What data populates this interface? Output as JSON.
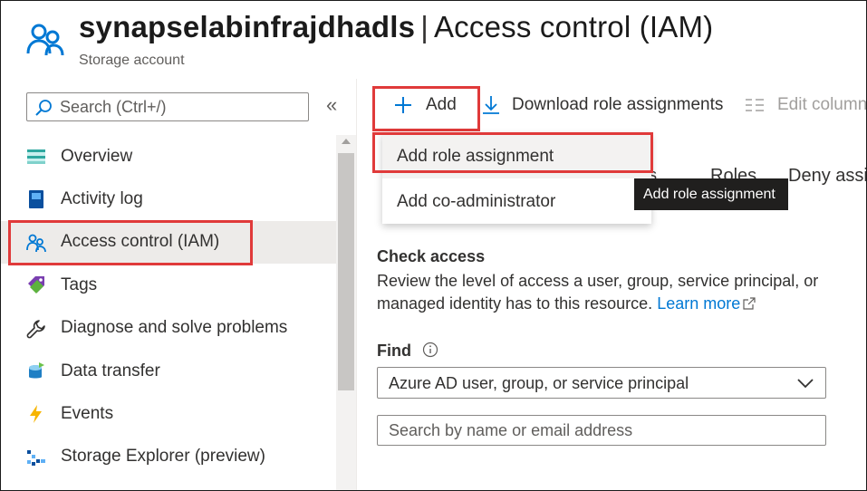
{
  "header": {
    "resource_name": "synapselabinfrajdhadls",
    "separator": "|",
    "page_title": "Access control (IAM)",
    "subtitle": "Storage account"
  },
  "sidebar": {
    "search_placeholder": "Search (Ctrl+/)",
    "collapse_glyph": "«",
    "items": [
      {
        "label": "Overview",
        "icon": "overview-icon"
      },
      {
        "label": "Activity log",
        "icon": "activity-log-icon"
      },
      {
        "label": "Access control (IAM)",
        "icon": "iam-people-icon",
        "active": true
      },
      {
        "label": "Tags",
        "icon": "tag-icon"
      },
      {
        "label": "Diagnose and solve problems",
        "icon": "wrench-icon"
      },
      {
        "label": "Data transfer",
        "icon": "data-transfer-icon"
      },
      {
        "label": "Events",
        "icon": "lightning-icon"
      },
      {
        "label": "Storage Explorer (preview)",
        "icon": "storage-explorer-icon"
      }
    ]
  },
  "toolbar": {
    "add_label": "Add",
    "download_label": "Download role assignments",
    "edit_columns_label": "Edit columns"
  },
  "tabs_behind": [
    "nts",
    "Roles",
    "Deny assi"
  ],
  "dropdown": {
    "items": [
      "Add role assignment",
      "Add co-administrator"
    ]
  },
  "tooltip": "Add role assignment",
  "check_access": {
    "title": "Check access",
    "description": "Review the level of access a user, group, service principal, or managed identity has to this resource.",
    "learn_more": "Learn more",
    "find_label": "Find",
    "find_select_value": "Azure AD user, group, or service principal",
    "search_placeholder": "Search by name or email address"
  },
  "colors": {
    "accent": "#0078d4",
    "highlight_box": "#e03a3a",
    "active_bg": "#edebe9",
    "tooltip_bg": "#201f1e"
  }
}
